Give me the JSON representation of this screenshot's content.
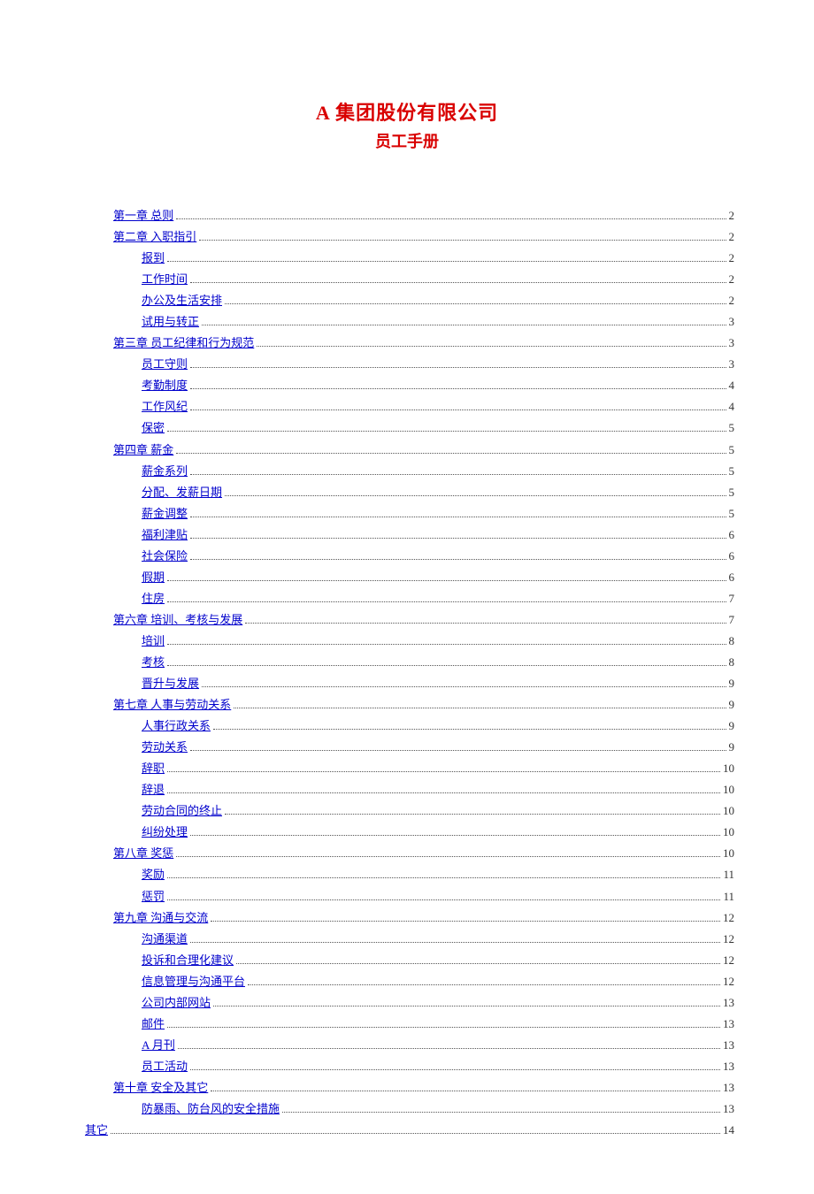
{
  "title": "A 集团股份有限公司",
  "subtitle": "员工手册",
  "toc": [
    {
      "label": "第一章  总则",
      "page": "2",
      "indent": 0
    },
    {
      "label": "第二章  入职指引",
      "page": "2",
      "indent": 0
    },
    {
      "label": "报到",
      "page": "2",
      "indent": 1
    },
    {
      "label": "工作时间",
      "page": "2",
      "indent": 1
    },
    {
      "label": "办公及生活安排",
      "page": "2",
      "indent": 1
    },
    {
      "label": "试用与转正",
      "page": "3",
      "indent": 1
    },
    {
      "label": "第三章  员工纪律和行为规范",
      "page": "3",
      "indent": 0
    },
    {
      "label": "员工守则",
      "page": "3",
      "indent": 1
    },
    {
      "label": "考勤制度",
      "page": "4",
      "indent": 1
    },
    {
      "label": "工作风纪",
      "page": "4",
      "indent": 1
    },
    {
      "label": "保密",
      "page": "5",
      "indent": 1
    },
    {
      "label": "第四章  薪金",
      "page": "5",
      "indent": 0
    },
    {
      "label": "薪金系列",
      "page": "5",
      "indent": 1
    },
    {
      "label": "分配、发薪日期",
      "page": "5",
      "indent": 1
    },
    {
      "label": "薪金调整",
      "page": "5",
      "indent": 1
    },
    {
      "label": "福利津贴",
      "page": "6",
      "indent": 1
    },
    {
      "label": "社会保险",
      "page": "6",
      "indent": 1
    },
    {
      "label": "假期",
      "page": "6",
      "indent": 1
    },
    {
      "label": "住房",
      "page": "7",
      "indent": 1
    },
    {
      "label": "第六章 培训、考核与发展",
      "page": "7",
      "indent": 0
    },
    {
      "label": "培训",
      "page": "8",
      "indent": 1
    },
    {
      "label": "考核",
      "page": "8",
      "indent": 1
    },
    {
      "label": "晋升与发展",
      "page": "9",
      "indent": 1
    },
    {
      "label": "第七章  人事与劳动关系",
      "page": "9",
      "indent": 0
    },
    {
      "label": "人事行政关系",
      "page": "9",
      "indent": 1
    },
    {
      "label": "劳动关系",
      "page": "9",
      "indent": 1
    },
    {
      "label": "辞职",
      "page": "10",
      "indent": 1
    },
    {
      "label": "辞退",
      "page": "10",
      "indent": 1
    },
    {
      "label": "劳动合同的终止",
      "page": "10",
      "indent": 1
    },
    {
      "label": "纠纷处理",
      "page": "10",
      "indent": 1
    },
    {
      "label": "第八章  奖惩",
      "page": "10",
      "indent": 0
    },
    {
      "label": "奖励",
      "page": "11",
      "indent": 1
    },
    {
      "label": "惩罚",
      "page": "11",
      "indent": 1
    },
    {
      "label": "第九章 沟通与交流",
      "page": "12",
      "indent": 0
    },
    {
      "label": "沟通渠道",
      "page": "12",
      "indent": 1
    },
    {
      "label": "投诉和合理化建议",
      "page": "12",
      "indent": 1
    },
    {
      "label": "信息管理与沟通平台",
      "page": "12",
      "indent": 1
    },
    {
      "label": "公司内部网站",
      "page": "13",
      "indent": 1
    },
    {
      "label": "邮件",
      "page": "13",
      "indent": 1
    },
    {
      "label": "A 月刊",
      "page": "13",
      "indent": 1
    },
    {
      "label": "员工活动",
      "page": "13",
      "indent": 1
    },
    {
      "label": "第十章  安全及其它",
      "page": "13",
      "indent": 0
    },
    {
      "label": "防暴雨、防台风的安全措施",
      "page": "13",
      "indent": 1
    },
    {
      "label": "其它",
      "page": "14",
      "indent": -1
    }
  ]
}
